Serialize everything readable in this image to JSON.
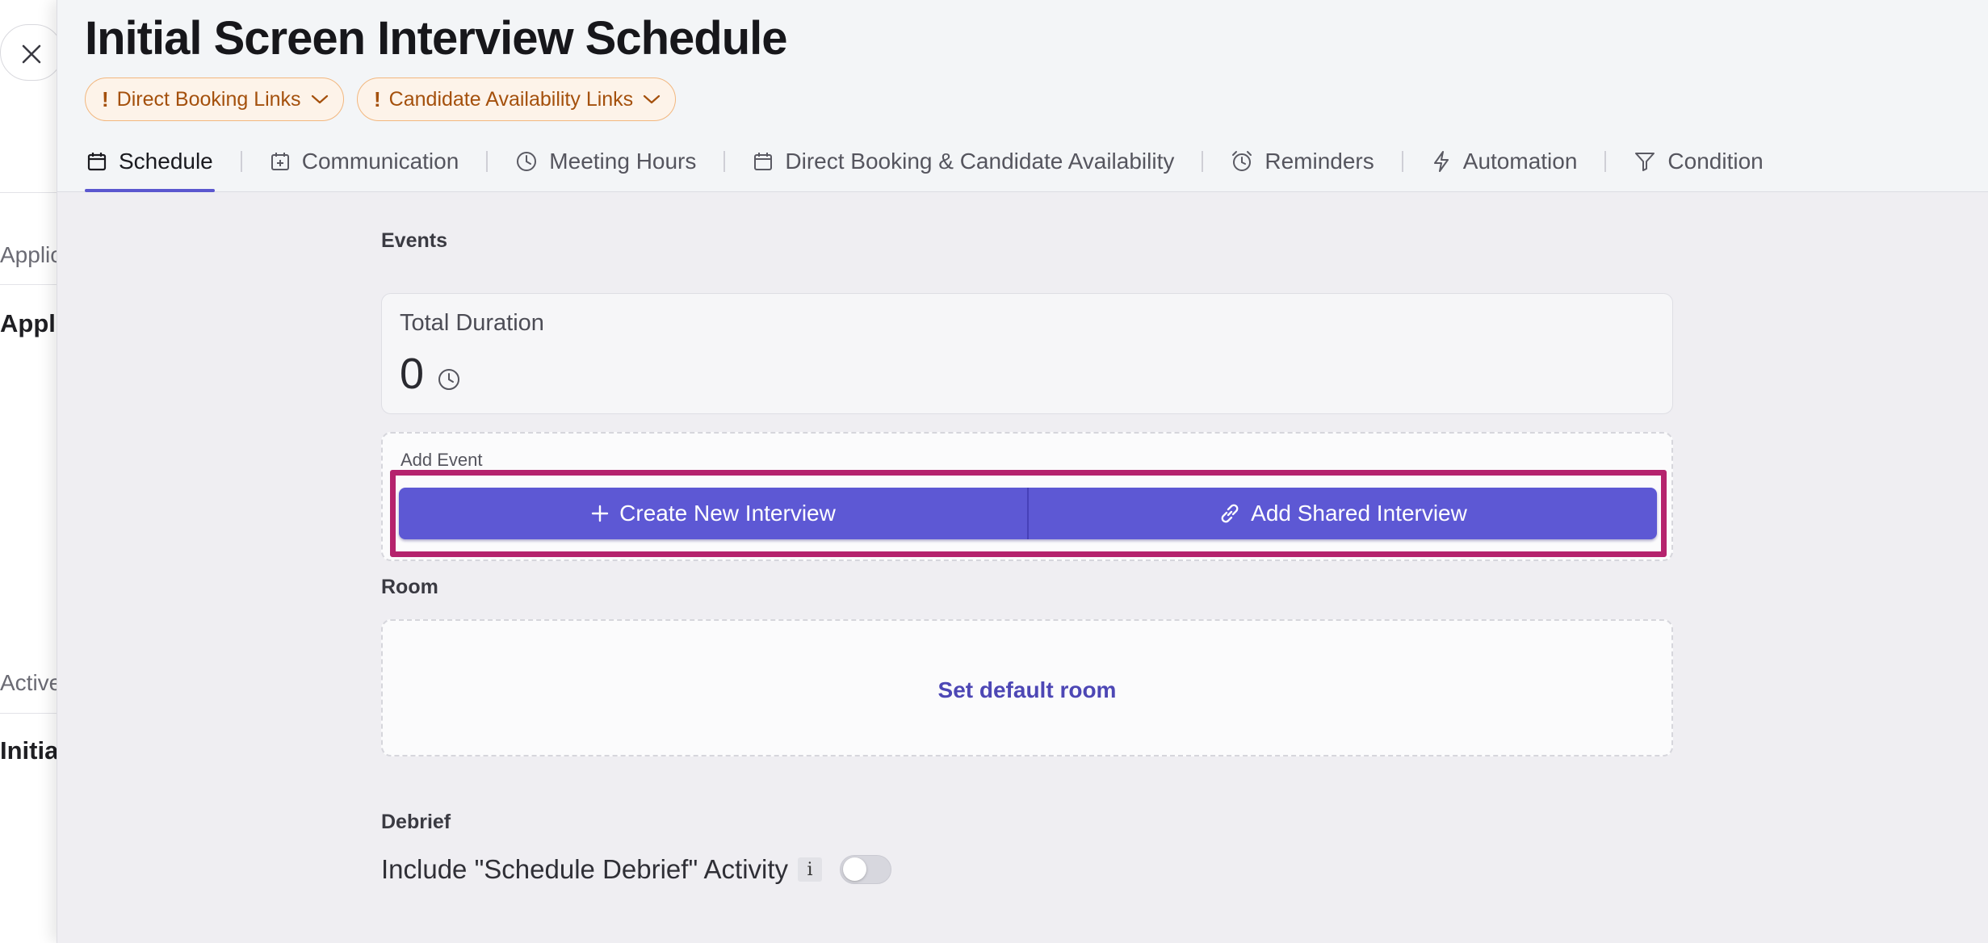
{
  "background_page": {
    "section1_label": "Applic",
    "section1_value": "Appli",
    "section2_label": "Active",
    "section2_value": "Initia"
  },
  "header": {
    "title": "Initial Screen Interview Schedule",
    "alerts": [
      {
        "mark": "!",
        "label": "Direct Booking Links"
      },
      {
        "mark": "!",
        "label": "Candidate Availability Links"
      }
    ]
  },
  "tabs": [
    {
      "label": "Schedule",
      "icon": "calendar-icon",
      "active": true
    },
    {
      "label": "Communication",
      "icon": "calendar-plus-icon"
    },
    {
      "label": "Meeting Hours",
      "icon": "clock-icon"
    },
    {
      "label": "Direct Booking & Candidate Availability",
      "icon": "calendar-icon"
    },
    {
      "label": "Reminders",
      "icon": "alarm-icon"
    },
    {
      "label": "Automation",
      "icon": "lightning-icon"
    },
    {
      "label": "Condition",
      "icon": "filter-icon"
    }
  ],
  "events": {
    "section_label": "Events",
    "total_duration_label": "Total Duration",
    "total_duration_value": "0",
    "add_event_label": "Add Event",
    "create_button": "Create New Interview",
    "shared_button": "Add Shared Interview"
  },
  "room": {
    "section_label": "Room",
    "link": "Set default room"
  },
  "debrief": {
    "section_label": "Debrief",
    "toggle_label": "Include \"Schedule Debrief\" Activity",
    "info_mark": "i",
    "enabled": false
  },
  "colors": {
    "accent": "#5d58d4",
    "highlight": "#b5236d",
    "warning": "#a4500c"
  }
}
